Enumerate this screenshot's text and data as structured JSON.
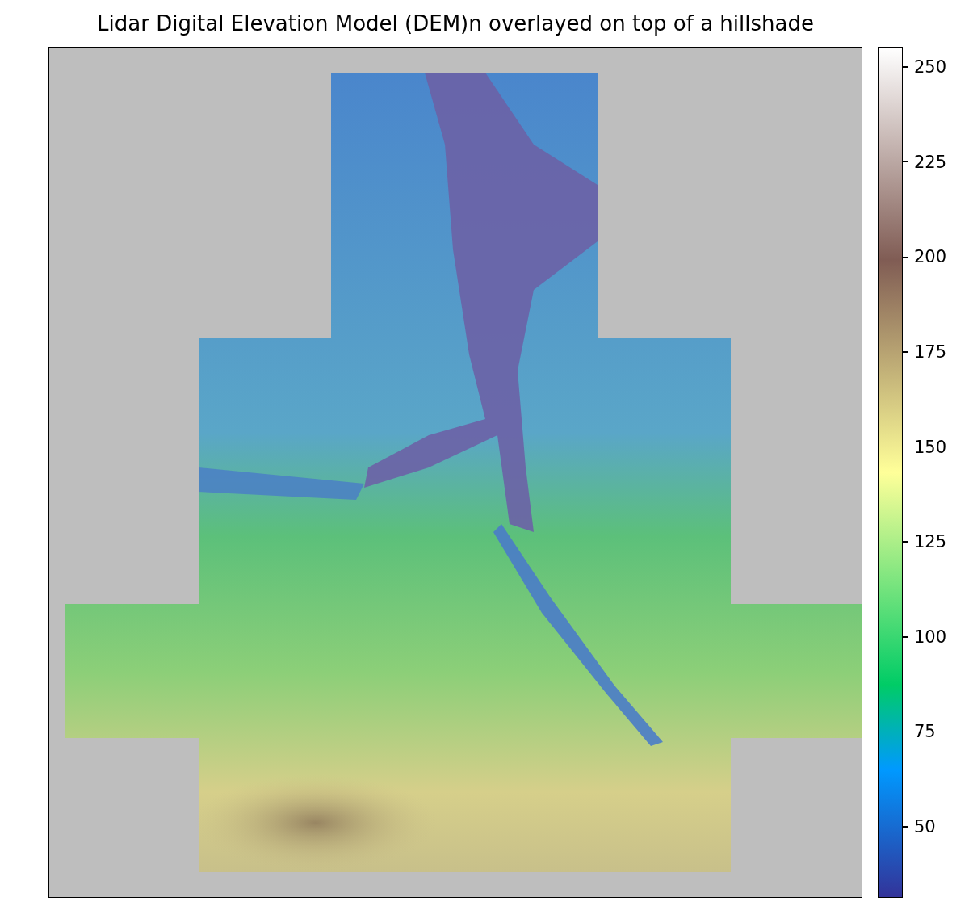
{
  "title": "Lidar Digital Elevation Model (DEM)n overlayed on top of a hillshade",
  "colorbar": {
    "ticks": [
      "250",
      "225",
      "200",
      "175",
      "150",
      "125",
      "100",
      "75",
      "50"
    ]
  }
}
